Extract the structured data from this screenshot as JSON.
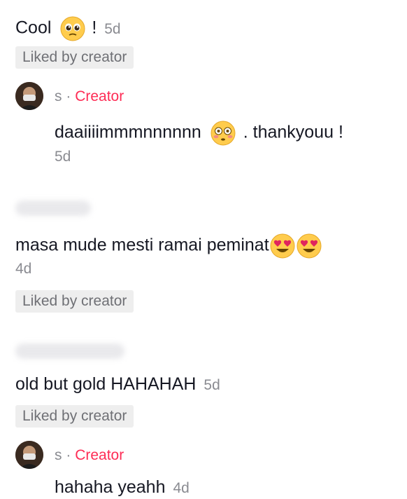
{
  "comments": [
    {
      "text": "Cool",
      "after_emoji": "!",
      "emoji_icon": "pleading-face-icon",
      "time": "5d",
      "badge": "Liked by creator",
      "reply": {
        "name": "s",
        "separator": "·",
        "role": "Creator",
        "text": "daaiiiimmmnnnnnn",
        "emoji_icon": "flushed-face-icon",
        "after_emoji": ". thankyouu !",
        "time": "5d"
      }
    },
    {
      "text": "masa mude mesti ramai peminat",
      "emoji_icon": "heart-eyes-icon",
      "time": "4d",
      "badge": "Liked by creator"
    },
    {
      "text": "old but gold HAHAHAH",
      "time": "5d",
      "badge": "Liked by creator",
      "reply": {
        "name": "s",
        "separator": "·",
        "role": "Creator",
        "text": "hahaha yeahh",
        "time": "4d"
      }
    }
  ],
  "colors": {
    "creator_accent": "#fe2c55",
    "text": "#161823",
    "muted": "#8a8b91",
    "badge_bg": "#eeeeee"
  }
}
